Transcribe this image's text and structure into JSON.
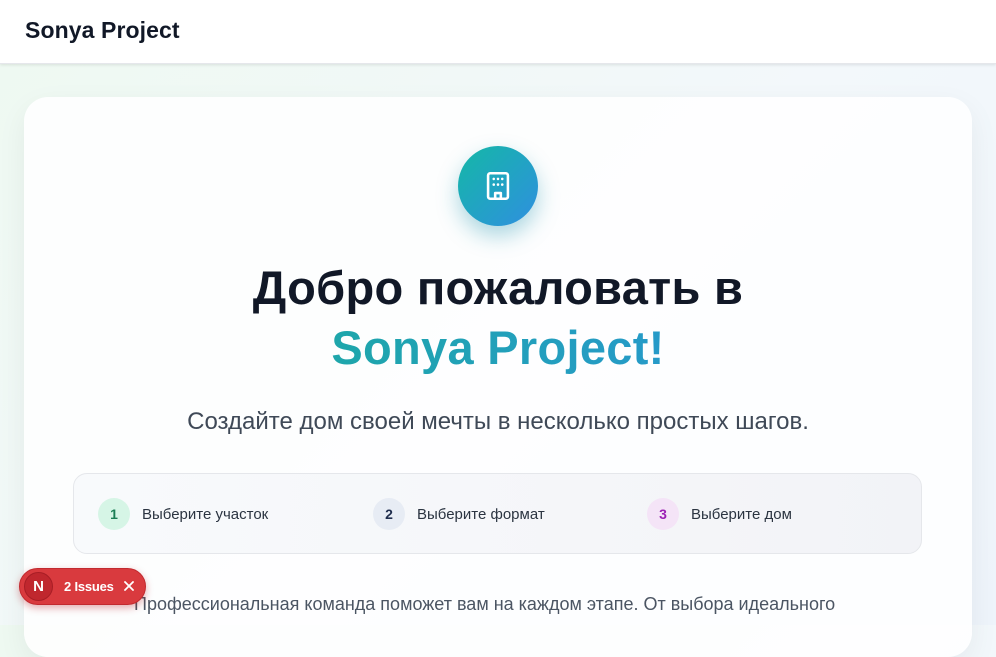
{
  "header": {
    "brand": "Sonya Project"
  },
  "hero": {
    "icon": "building-icon",
    "title_line1": "Добро пожаловать в",
    "title_line2": "Sonya Project!",
    "subtitle": "Создайте дом своей мечты в несколько простых шагов."
  },
  "steps": [
    {
      "number": "1",
      "label": "Выберите участок"
    },
    {
      "number": "2",
      "label": "Выберите формат"
    },
    {
      "number": "3",
      "label": "Выберите дом"
    }
  ],
  "description": "Профессиональная команда поможет вам на каждом этапе. От выбора идеального",
  "dev_overlay": {
    "avatar_letter": "N",
    "issues_label": "2 Issues",
    "close_icon": "close-icon"
  },
  "colors": {
    "accent_gradient_start": "#17b18f",
    "accent_gradient_end": "#2d8fe4",
    "issues_badge": "#d93a3e"
  }
}
